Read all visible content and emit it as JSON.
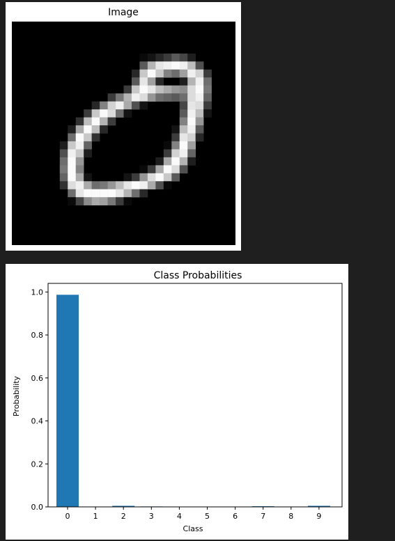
{
  "image_panel": {
    "title": "Image"
  },
  "chart_data": {
    "type": "bar",
    "title": "Class Probabilities",
    "xlabel": "Class",
    "ylabel": "Probability",
    "categories": [
      "0",
      "1",
      "2",
      "3",
      "4",
      "5",
      "6",
      "7",
      "8",
      "9"
    ],
    "values": [
      0.987,
      0.0003,
      0.005,
      0.002,
      0.0002,
      0.0002,
      0.0002,
      0.003,
      0.0003,
      0.005
    ],
    "ylim": [
      0.0,
      1.04
    ],
    "yticks": [
      "0.0",
      "0.2",
      "0.4",
      "0.6",
      "0.8",
      "1.0"
    ],
    "bar_color": "#1f77b4",
    "grid": false
  },
  "digit_pixels": {
    "rows": 28,
    "cols": 28,
    "grid": [
      [
        0,
        0,
        0,
        0,
        0,
        0,
        0,
        0,
        0,
        0,
        0,
        0,
        0,
        0,
        0,
        0,
        0,
        0,
        0,
        0,
        0,
        0,
        0,
        0,
        0,
        0,
        0,
        0
      ],
      [
        0,
        0,
        0,
        0,
        0,
        0,
        0,
        0,
        0,
        0,
        0,
        0,
        0,
        0,
        0,
        0,
        0,
        0,
        0,
        0,
        0,
        0,
        0,
        0,
        0,
        0,
        0,
        0
      ],
      [
        0,
        0,
        0,
        0,
        0,
        0,
        0,
        0,
        0,
        0,
        0,
        0,
        0,
        0,
        0,
        0,
        0,
        0,
        0,
        0,
        0,
        0,
        0,
        0,
        0,
        0,
        0,
        0
      ],
      [
        0,
        0,
        0,
        0,
        0,
        0,
        0,
        0,
        0,
        0,
        0,
        0,
        0,
        0,
        0,
        0,
        0,
        0,
        0,
        0,
        0,
        0,
        0,
        0,
        0,
        0,
        0,
        0
      ],
      [
        0,
        0,
        0,
        0,
        0,
        0,
        0,
        0,
        0,
        0,
        0,
        0,
        0,
        0,
        0,
        0,
        10,
        20,
        40,
        60,
        90,
        70,
        30,
        0,
        0,
        0,
        0,
        0
      ],
      [
        0,
        0,
        0,
        0,
        0,
        0,
        0,
        0,
        0,
        0,
        0,
        0,
        0,
        0,
        0,
        0,
        90,
        180,
        230,
        240,
        250,
        240,
        190,
        80,
        0,
        0,
        0,
        0
      ],
      [
        0,
        0,
        0,
        0,
        0,
        0,
        0,
        0,
        0,
        0,
        0,
        0,
        0,
        0,
        0,
        40,
        200,
        250,
        200,
        130,
        110,
        160,
        240,
        210,
        60,
        0,
        0,
        0
      ],
      [
        0,
        0,
        0,
        0,
        0,
        0,
        0,
        0,
        0,
        0,
        0,
        0,
        0,
        0,
        0,
        90,
        230,
        160,
        40,
        0,
        0,
        30,
        180,
        240,
        110,
        0,
        0,
        0
      ],
      [
        0,
        0,
        0,
        0,
        0,
        0,
        0,
        0,
        0,
        0,
        0,
        0,
        0,
        0,
        60,
        200,
        250,
        230,
        190,
        170,
        150,
        140,
        220,
        250,
        120,
        0,
        0,
        0
      ],
      [
        0,
        0,
        0,
        0,
        0,
        0,
        0,
        0,
        0,
        0,
        0,
        0,
        60,
        120,
        180,
        240,
        220,
        150,
        110,
        100,
        90,
        110,
        220,
        240,
        100,
        0,
        0,
        0
      ],
      [
        0,
        0,
        0,
        0,
        0,
        0,
        0,
        0,
        0,
        0,
        40,
        130,
        210,
        240,
        170,
        80,
        20,
        0,
        0,
        0,
        0,
        70,
        230,
        220,
        60,
        0,
        0,
        0
      ],
      [
        0,
        0,
        0,
        0,
        0,
        0,
        0,
        0,
        0,
        60,
        200,
        250,
        220,
        110,
        20,
        0,
        0,
        0,
        0,
        0,
        0,
        90,
        240,
        190,
        20,
        0,
        0,
        0
      ],
      [
        0,
        0,
        0,
        0,
        0,
        0,
        0,
        0,
        50,
        190,
        250,
        180,
        60,
        0,
        0,
        0,
        0,
        0,
        0,
        0,
        0,
        130,
        250,
        150,
        0,
        0,
        0,
        0
      ],
      [
        0,
        0,
        0,
        0,
        0,
        0,
        0,
        30,
        170,
        250,
        190,
        40,
        0,
        0,
        0,
        0,
        0,
        0,
        0,
        0,
        20,
        190,
        240,
        90,
        0,
        0,
        0,
        0
      ],
      [
        0,
        0,
        0,
        0,
        0,
        0,
        0,
        110,
        250,
        200,
        50,
        0,
        0,
        0,
        0,
        0,
        0,
        0,
        0,
        0,
        60,
        230,
        210,
        40,
        0,
        0,
        0,
        0
      ],
      [
        0,
        0,
        0,
        0,
        0,
        0,
        30,
        200,
        240,
        100,
        0,
        0,
        0,
        0,
        0,
        0,
        0,
        0,
        0,
        10,
        130,
        250,
        160,
        0,
        0,
        0,
        0,
        0
      ],
      [
        0,
        0,
        0,
        0,
        0,
        0,
        80,
        240,
        200,
        30,
        0,
        0,
        0,
        0,
        0,
        0,
        0,
        0,
        0,
        60,
        210,
        240,
        100,
        0,
        0,
        0,
        0,
        0
      ],
      [
        0,
        0,
        0,
        0,
        0,
        0,
        110,
        250,
        150,
        0,
        0,
        0,
        0,
        0,
        0,
        0,
        0,
        0,
        30,
        170,
        250,
        180,
        30,
        0,
        0,
        0,
        0,
        0
      ],
      [
        0,
        0,
        0,
        0,
        0,
        0,
        120,
        250,
        130,
        0,
        0,
        0,
        0,
        0,
        0,
        0,
        10,
        60,
        170,
        250,
        220,
        80,
        0,
        0,
        0,
        0,
        0,
        0
      ],
      [
        0,
        0,
        0,
        0,
        0,
        0,
        100,
        250,
        170,
        20,
        0,
        0,
        0,
        0,
        20,
        60,
        150,
        220,
        250,
        200,
        90,
        0,
        0,
        0,
        0,
        0,
        0,
        0
      ],
      [
        0,
        0,
        0,
        0,
        0,
        0,
        50,
        220,
        240,
        170,
        110,
        120,
        150,
        190,
        230,
        250,
        240,
        170,
        80,
        10,
        0,
        0,
        0,
        0,
        0,
        0,
        0,
        0
      ],
      [
        0,
        0,
        0,
        0,
        0,
        0,
        0,
        110,
        230,
        250,
        250,
        250,
        250,
        230,
        180,
        110,
        40,
        0,
        0,
        0,
        0,
        0,
        0,
        0,
        0,
        0,
        0,
        0
      ],
      [
        0,
        0,
        0,
        0,
        0,
        0,
        0,
        10,
        70,
        140,
        170,
        160,
        120,
        60,
        10,
        0,
        0,
        0,
        0,
        0,
        0,
        0,
        0,
        0,
        0,
        0,
        0,
        0
      ],
      [
        0,
        0,
        0,
        0,
        0,
        0,
        0,
        0,
        0,
        0,
        0,
        0,
        0,
        0,
        0,
        0,
        0,
        0,
        0,
        0,
        0,
        0,
        0,
        0,
        0,
        0,
        0,
        0
      ],
      [
        0,
        0,
        0,
        0,
        0,
        0,
        0,
        0,
        0,
        0,
        0,
        0,
        0,
        0,
        0,
        0,
        0,
        0,
        0,
        0,
        0,
        0,
        0,
        0,
        0,
        0,
        0,
        0
      ],
      [
        0,
        0,
        0,
        0,
        0,
        0,
        0,
        0,
        0,
        0,
        0,
        0,
        0,
        0,
        0,
        0,
        0,
        0,
        0,
        0,
        0,
        0,
        0,
        0,
        0,
        0,
        0,
        0
      ],
      [
        0,
        0,
        0,
        0,
        0,
        0,
        0,
        0,
        0,
        0,
        0,
        0,
        0,
        0,
        0,
        0,
        0,
        0,
        0,
        0,
        0,
        0,
        0,
        0,
        0,
        0,
        0,
        0
      ],
      [
        0,
        0,
        0,
        0,
        0,
        0,
        0,
        0,
        0,
        0,
        0,
        0,
        0,
        0,
        0,
        0,
        0,
        0,
        0,
        0,
        0,
        0,
        0,
        0,
        0,
        0,
        0,
        0
      ]
    ]
  }
}
